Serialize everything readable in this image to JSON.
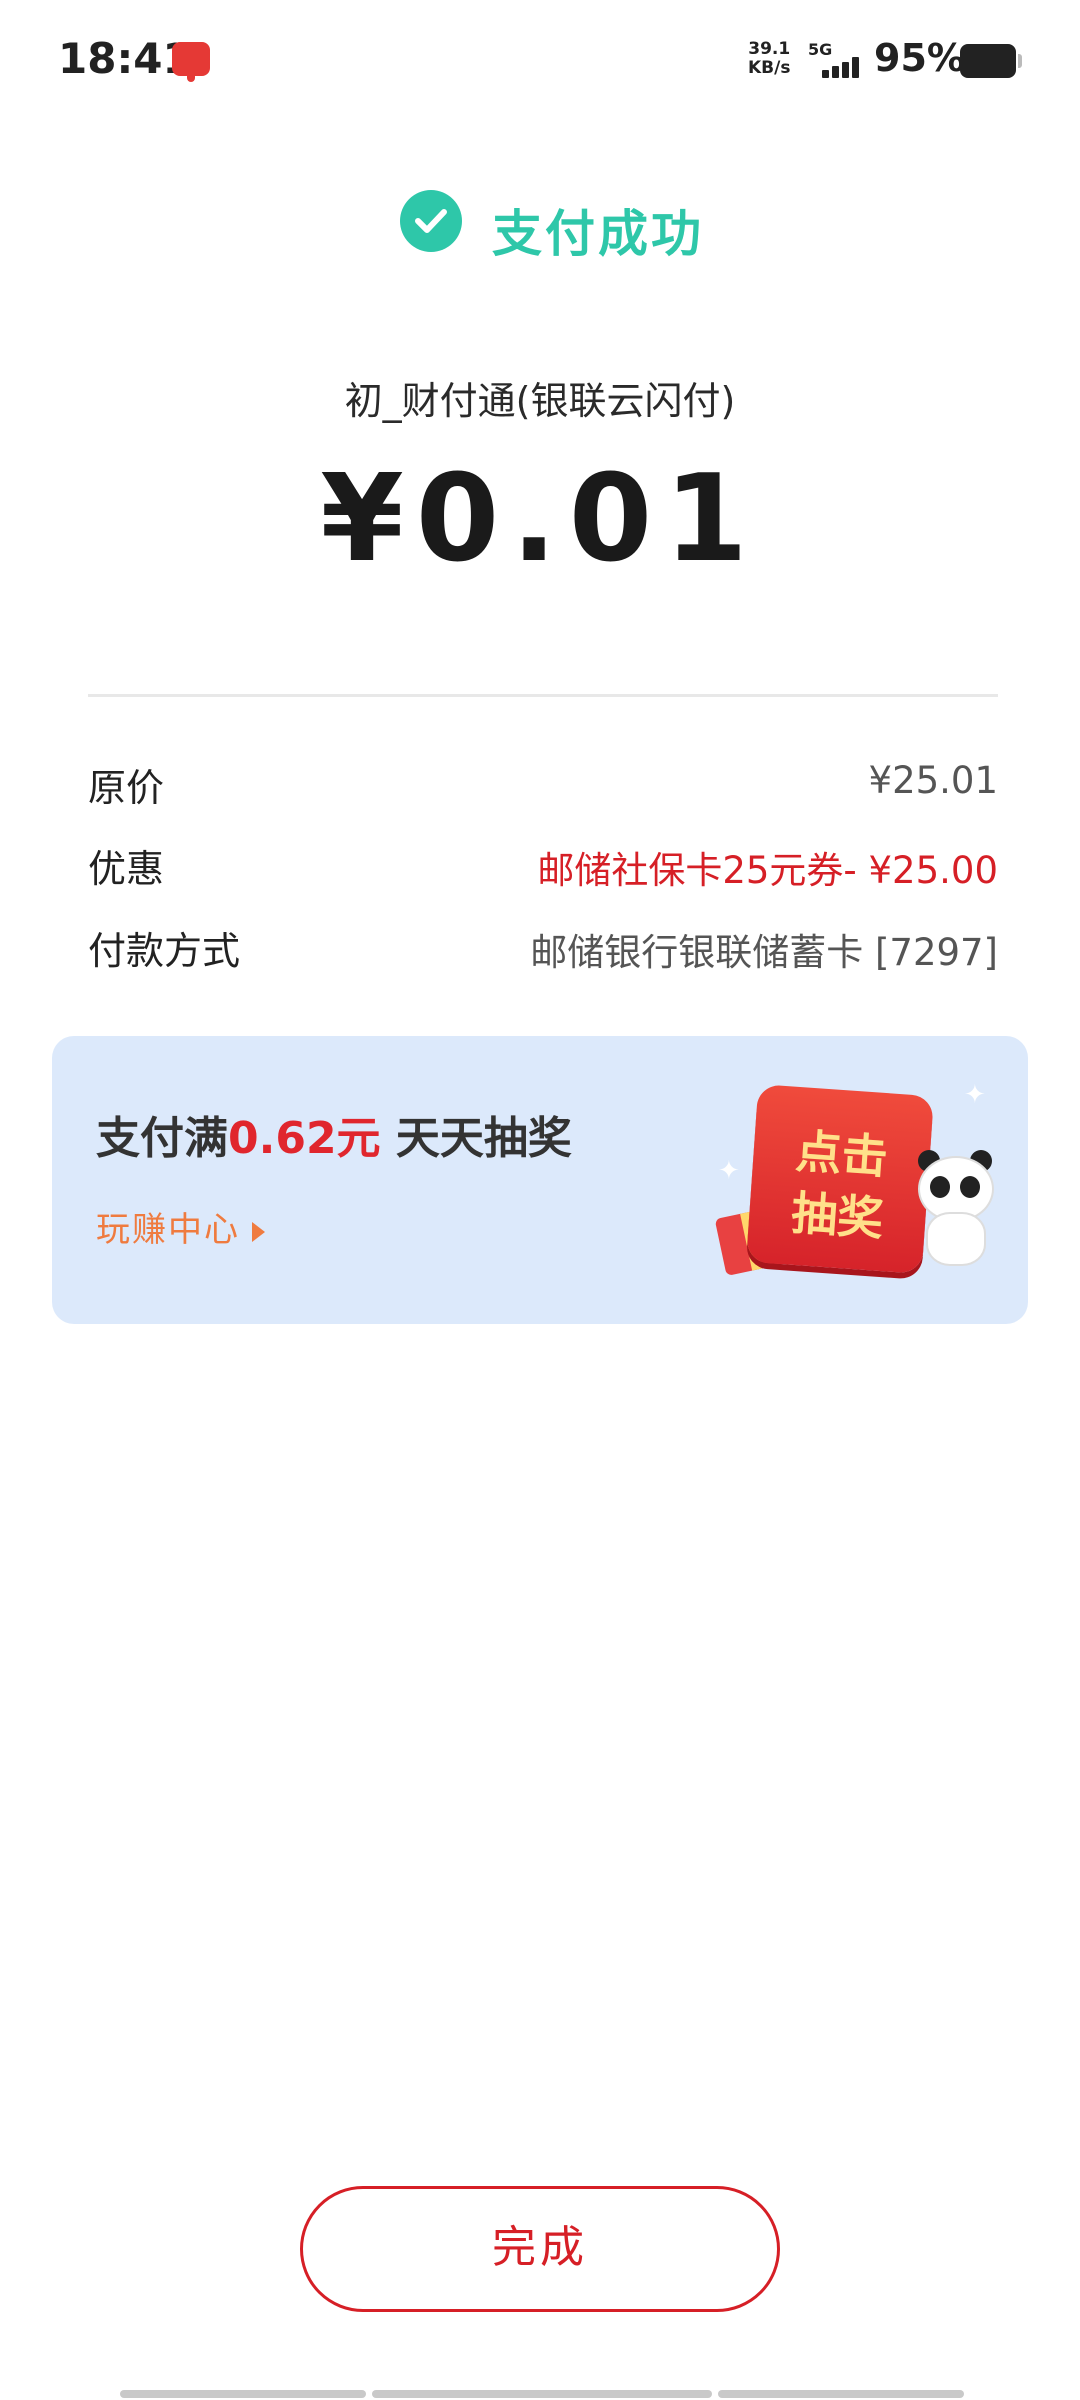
{
  "status_bar": {
    "time": "18:41",
    "net_speed_value": "39.1",
    "net_speed_unit": "KB/s",
    "network_type": "5G",
    "battery": "95%"
  },
  "header": {
    "status_text": "支付成功",
    "status_color": "#2ec7a9"
  },
  "payment": {
    "merchant": "初_财付通(银联云闪付)",
    "amount": "¥0.01"
  },
  "details": [
    {
      "label": "原价",
      "value": "¥25.01"
    },
    {
      "label": "优惠",
      "value": "邮储社保卡25元券- ¥25.00"
    },
    {
      "label": "付款方式",
      "value": "邮储银行银联储蓄卡 [7297]"
    }
  ],
  "promo": {
    "title_prefix": "支付满",
    "title_amount": "0.62元",
    "title_suffix": " 天天抽奖",
    "link": "玩赚中心",
    "button_line1": "点击",
    "button_line2": "抽奖"
  },
  "actions": {
    "done_label": "完成"
  },
  "colors": {
    "accent_red": "#d61f26",
    "promo_bg": "#dce9fb",
    "link_orange": "#ef7b3f"
  }
}
